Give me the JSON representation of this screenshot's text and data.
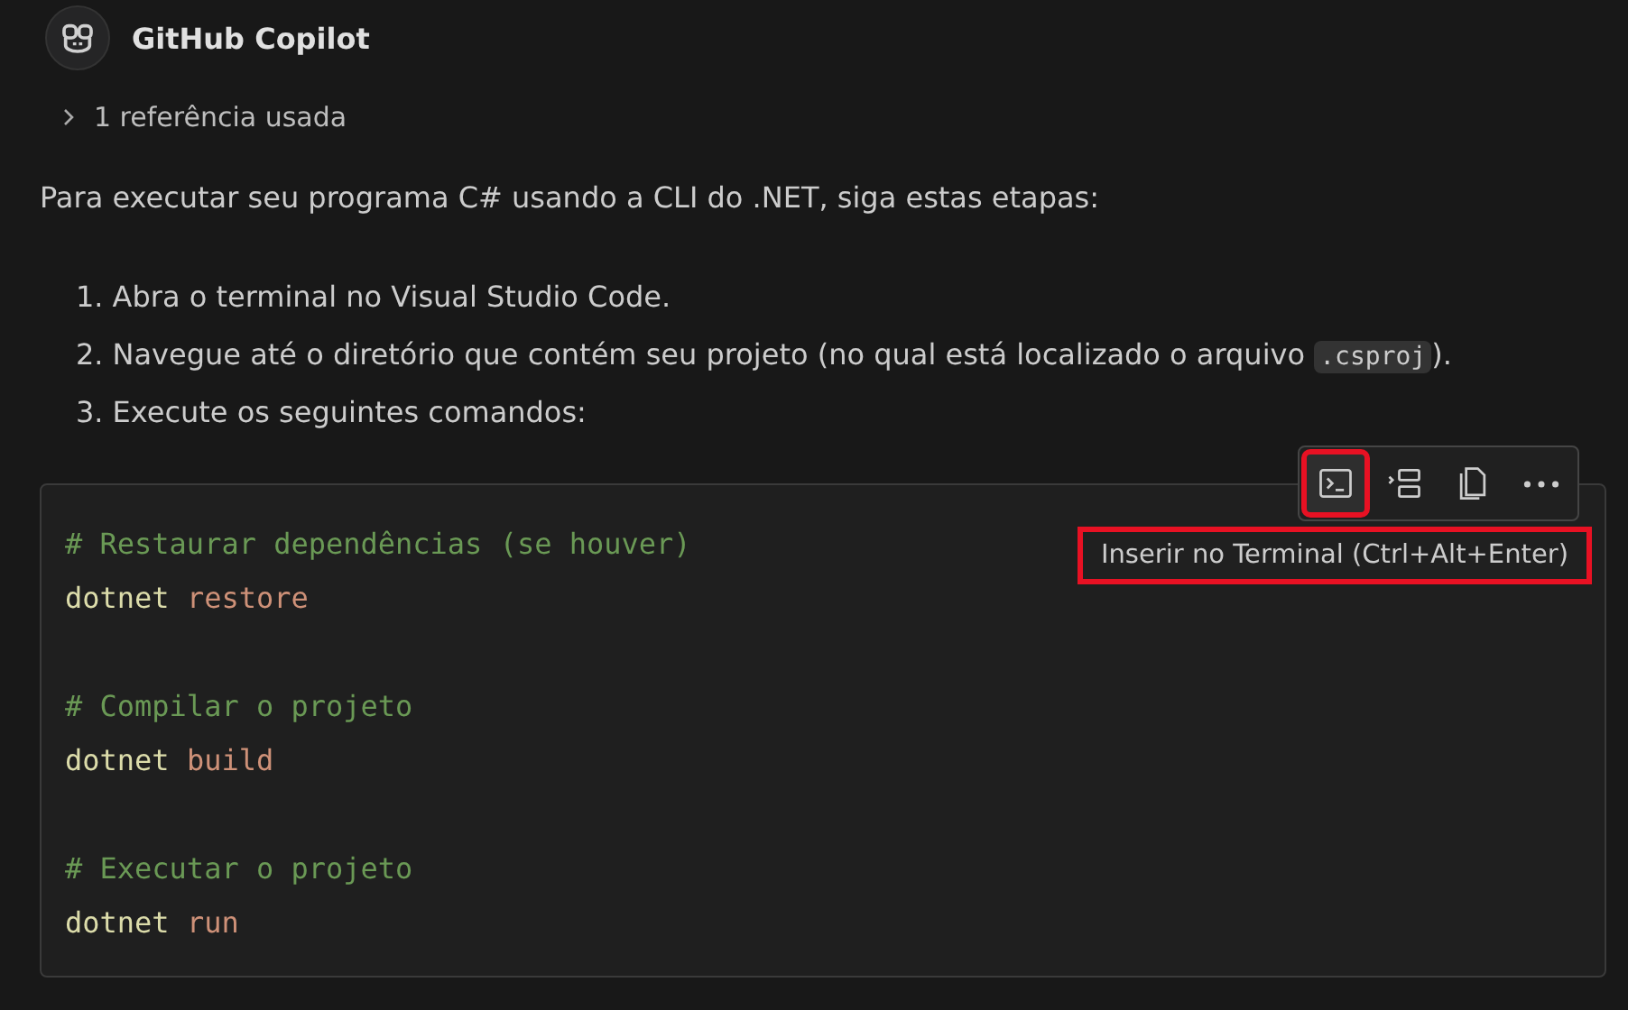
{
  "header": {
    "title": "GitHub Copilot"
  },
  "references": {
    "label": "1 referência usada",
    "expanded": false
  },
  "intro": "Para executar seu programa C# usando a CLI do .NET, siga estas etapas:",
  "steps": [
    {
      "number": "1.",
      "text": "Abra o terminal no Visual Studio Code."
    },
    {
      "number": "2.",
      "text": "Navegue até o diretório que contém seu projeto (no qual está localizado o arquivo ",
      "code": ".csproj",
      "after": ")."
    },
    {
      "number": "3.",
      "text": "Execute os seguintes comandos:"
    }
  ],
  "code_block": {
    "lines": [
      {
        "kind": "comment",
        "text": "# Restaurar dependências (se houver)"
      },
      {
        "kind": "command",
        "command": "dotnet",
        "argument": "restore"
      },
      {
        "kind": "blank"
      },
      {
        "kind": "comment",
        "text": "# Compilar o projeto"
      },
      {
        "kind": "command",
        "command": "dotnet",
        "argument": "build"
      },
      {
        "kind": "blank"
      },
      {
        "kind": "comment",
        "text": "# Executar o projeto"
      },
      {
        "kind": "command",
        "command": "dotnet",
        "argument": "run"
      }
    ],
    "toolbar": [
      {
        "kind": "terminal",
        "highlighted": true
      },
      {
        "kind": "insert",
        "highlighted": false
      },
      {
        "kind": "copy",
        "highlighted": false
      },
      {
        "kind": "more",
        "highlighted": false
      }
    ],
    "tooltip": {
      "text": "Inserir no Terminal (Ctrl+Alt+Enter)",
      "highlighted": true
    }
  }
}
